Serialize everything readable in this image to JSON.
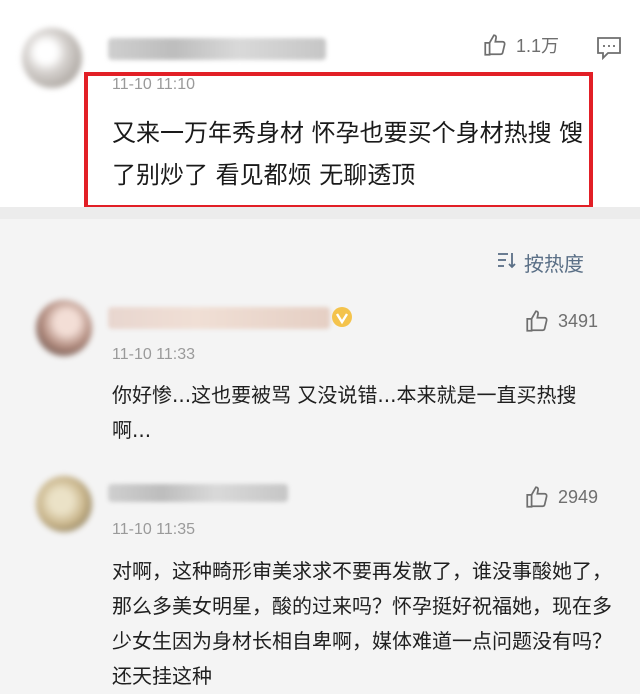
{
  "featured": {
    "time": "11-10 11:10",
    "likes": "1.1万",
    "text": "又来一万年秀身材 怀孕也要买个身材热搜 馊了别炒了 看见都烦 无聊透顶"
  },
  "sort": {
    "label": "按热度"
  },
  "comments": [
    {
      "time": "11-10 11:33",
      "likes": "3491",
      "text": "你好惨...这也要被骂 又没说错...本来就是一直买热搜啊..."
    },
    {
      "time": "11-10 11:35",
      "likes": "2949",
      "text": "对啊，这种畸形审美求求不要再发散了，谁没事酸她了，那么多美女明星，酸的过来吗？怀孕挺好祝福她，现在多少女生因为身材长相自卑啊，媒体难道一点问题没有吗？还天挂这种"
    }
  ],
  "colors": {
    "highlight": "#e21f26",
    "sort_text": "#5a6f86"
  }
}
